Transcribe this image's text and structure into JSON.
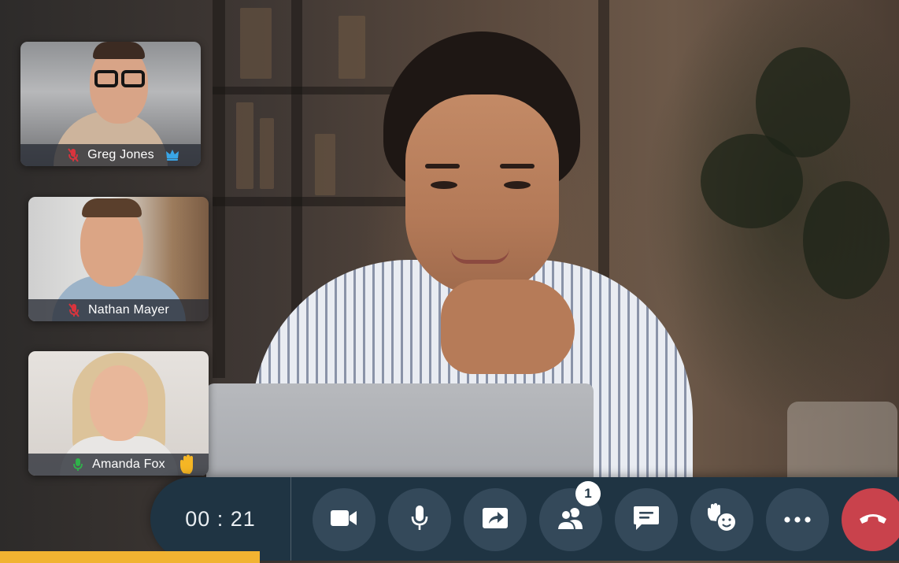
{
  "participants": [
    {
      "name": "Greg Jones",
      "mic": "muted",
      "mic_icon": "mic-muted-icon",
      "badge_icon": "crown-icon",
      "badge_color": "#39a6e6"
    },
    {
      "name": "Nathan Mayer",
      "mic": "muted",
      "mic_icon": "mic-muted-icon"
    },
    {
      "name": "Amanda Fox",
      "mic": "active",
      "mic_icon": "mic-active-icon",
      "badge_icon": "raised-hand-icon",
      "badge_color": "#f5b625"
    }
  ],
  "call": {
    "timer": "00 : 21",
    "participants_badge": "1"
  },
  "controls": [
    {
      "id": "camera",
      "icon": "video-camera-icon"
    },
    {
      "id": "microphone",
      "icon": "microphone-icon"
    },
    {
      "id": "share-screen",
      "icon": "share-screen-icon"
    },
    {
      "id": "participants",
      "icon": "participants-icon"
    },
    {
      "id": "chat",
      "icon": "chat-icon"
    },
    {
      "id": "reactions",
      "icon": "raise-hand-reaction-icon"
    },
    {
      "id": "more",
      "icon": "more-options-icon"
    },
    {
      "id": "end-call",
      "icon": "end-call-icon"
    }
  ],
  "colors": {
    "control_bar": "#1f3443",
    "button": "#34495a",
    "end_call": "#c9424c",
    "muted_mic": "#d9343d",
    "active_mic": "#2fb24a",
    "raised_hand": "#f5b625",
    "crown": "#39a6e6",
    "accent_strip": "#f1b331"
  }
}
